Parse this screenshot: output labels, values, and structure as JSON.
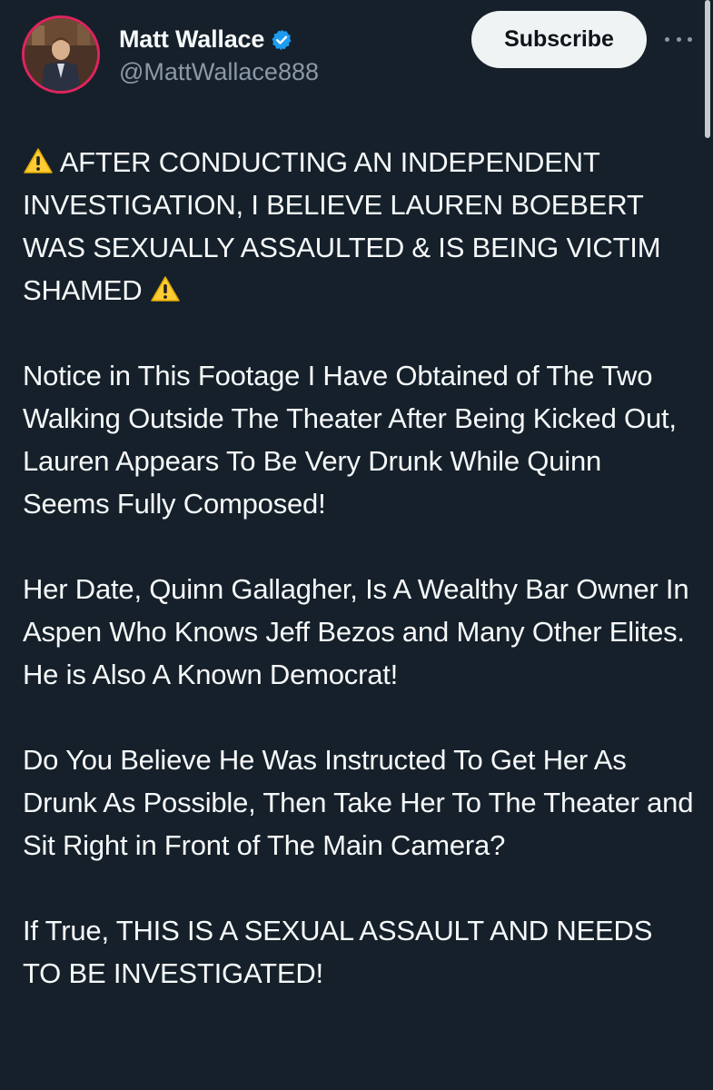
{
  "author": {
    "display_name": "Matt Wallace",
    "handle": "@MattWallace888",
    "verified": true,
    "verified_color": "#1d9bf0"
  },
  "actions": {
    "subscribe_label": "Subscribe",
    "more_icon": "more-horizontal-icon"
  },
  "post": {
    "warning_icon": "warning-emoji",
    "p1_text": "AFTER CONDUCTING AN INDEPENDENT INVESTIGATION, I BELIEVE LAUREN BOEBERT WAS SEXUALLY ASSAULTED & IS BEING VICTIM SHAMED",
    "p2": "Notice in This Footage I Have Obtained of The Two Walking Outside The Theater After Being Kicked Out, Lauren Appears To Be Very Drunk While Quinn Seems Fully Composed!",
    "p3": "Her Date, Quinn Gallagher, Is A Wealthy Bar Owner In Aspen Who Knows Jeff Bezos and Many Other Elites. He is Also A Known Democrat!",
    "p4": "Do You Believe He Was Instructed To Get Her As Drunk As Possible, Then Take Her To The Theater and Sit Right in Front of The Main Camera?",
    "p5": "If True, THIS IS A SEXUAL ASSAULT AND NEEDS TO BE INVESTIGATED!"
  },
  "theme": {
    "background": "#15202b",
    "text": "#f7f9f9",
    "secondary_text": "#8b98a5",
    "avatar_ring": "#e0245e"
  }
}
